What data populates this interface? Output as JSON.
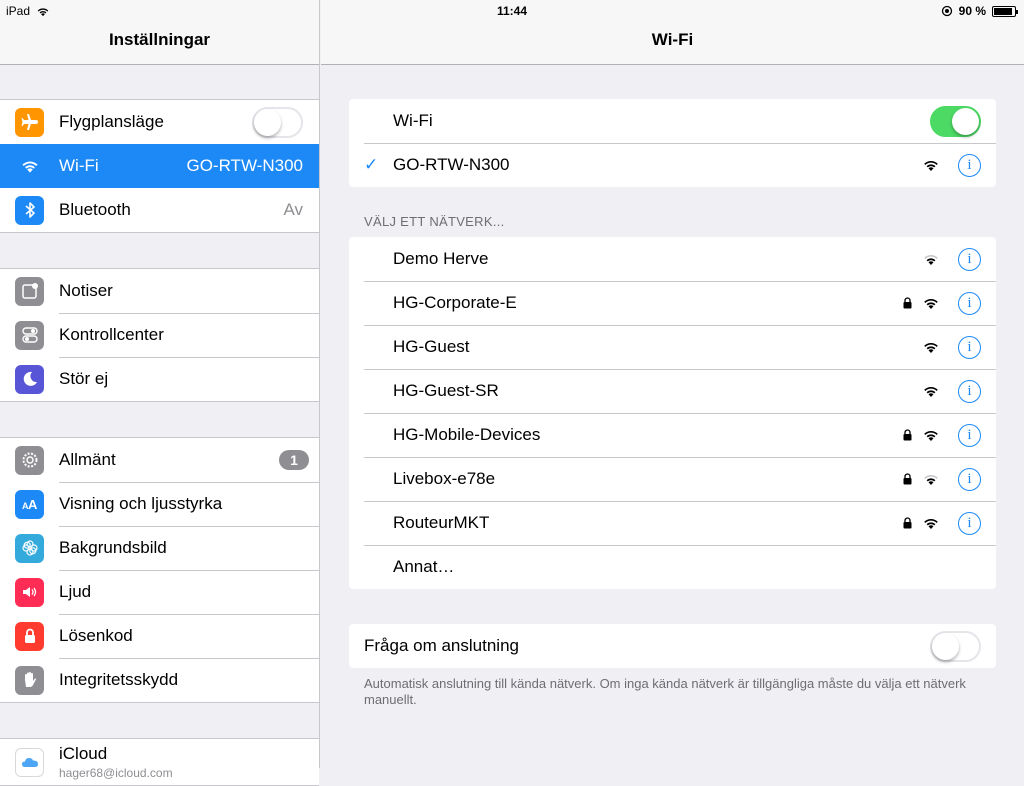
{
  "status_bar": {
    "device": "iPad",
    "time": "11:44",
    "battery": "90 %",
    "battery_level": 0.9
  },
  "sidebar": {
    "title": "Inställningar",
    "groups": [
      [
        {
          "label": "Flygplansläge",
          "icon": "airplane-icon",
          "color": "#ff9500",
          "toggle": false
        },
        {
          "label": "Wi-Fi",
          "icon": "wifi-icon",
          "color": "#1c89f7",
          "value": "GO-RTW-N300",
          "selected": true
        },
        {
          "label": "Bluetooth",
          "icon": "bluetooth-icon",
          "color": "#1c89f7",
          "value": "Av"
        }
      ],
      [
        {
          "label": "Notiser",
          "icon": "notifications-icon",
          "color": "#8e8e93"
        },
        {
          "label": "Kontrollcenter",
          "icon": "control-center-icon",
          "color": "#8e8e93"
        },
        {
          "label": "Stör ej",
          "icon": "moon-icon",
          "color": "#5856d6"
        }
      ],
      [
        {
          "label": "Allmänt",
          "icon": "gear-icon",
          "color": "#8e8e93",
          "badge": "1"
        },
        {
          "label": "Visning och ljusstyrka",
          "icon": "display-icon",
          "color": "#1c89f7"
        },
        {
          "label": "Bakgrundsbild",
          "icon": "wallpaper-icon",
          "color": "#34aadc"
        },
        {
          "label": "Ljud",
          "icon": "speaker-icon",
          "color": "#ff2d55"
        },
        {
          "label": "Lösenkod",
          "icon": "lock-icon",
          "color": "#ff3b30"
        },
        {
          "label": "Integritetsskydd",
          "icon": "hand-icon",
          "color": "#8e8e93"
        }
      ]
    ],
    "icloud": {
      "label": "iCloud",
      "email": "hager68@icloud.com"
    }
  },
  "main": {
    "title": "Wi-Fi",
    "wifi_label": "Wi-Fi",
    "wifi_on": true,
    "connected_network": "GO-RTW-N300",
    "section_title": "VÄLJ ETT NÄTVERK...",
    "networks": [
      {
        "name": "Demo Herve",
        "locked": false,
        "signal": 2
      },
      {
        "name": "HG-Corporate-E",
        "locked": true,
        "signal": 3
      },
      {
        "name": "HG-Guest",
        "locked": false,
        "signal": 3
      },
      {
        "name": "HG-Guest-SR",
        "locked": false,
        "signal": 3
      },
      {
        "name": "HG-Mobile-Devices",
        "locked": true,
        "signal": 3
      },
      {
        "name": "Livebox-e78e",
        "locked": true,
        "signal": 2
      },
      {
        "name": "RouteurMKT",
        "locked": true,
        "signal": 3
      }
    ],
    "other_label": "Annat…",
    "ask_label": "Fråga om anslutning",
    "ask_on": false,
    "footnote": "Automatisk anslutning till kända nätverk. Om inga kända nätverk är tillgängliga måste du välja ett nätverk manuellt."
  }
}
